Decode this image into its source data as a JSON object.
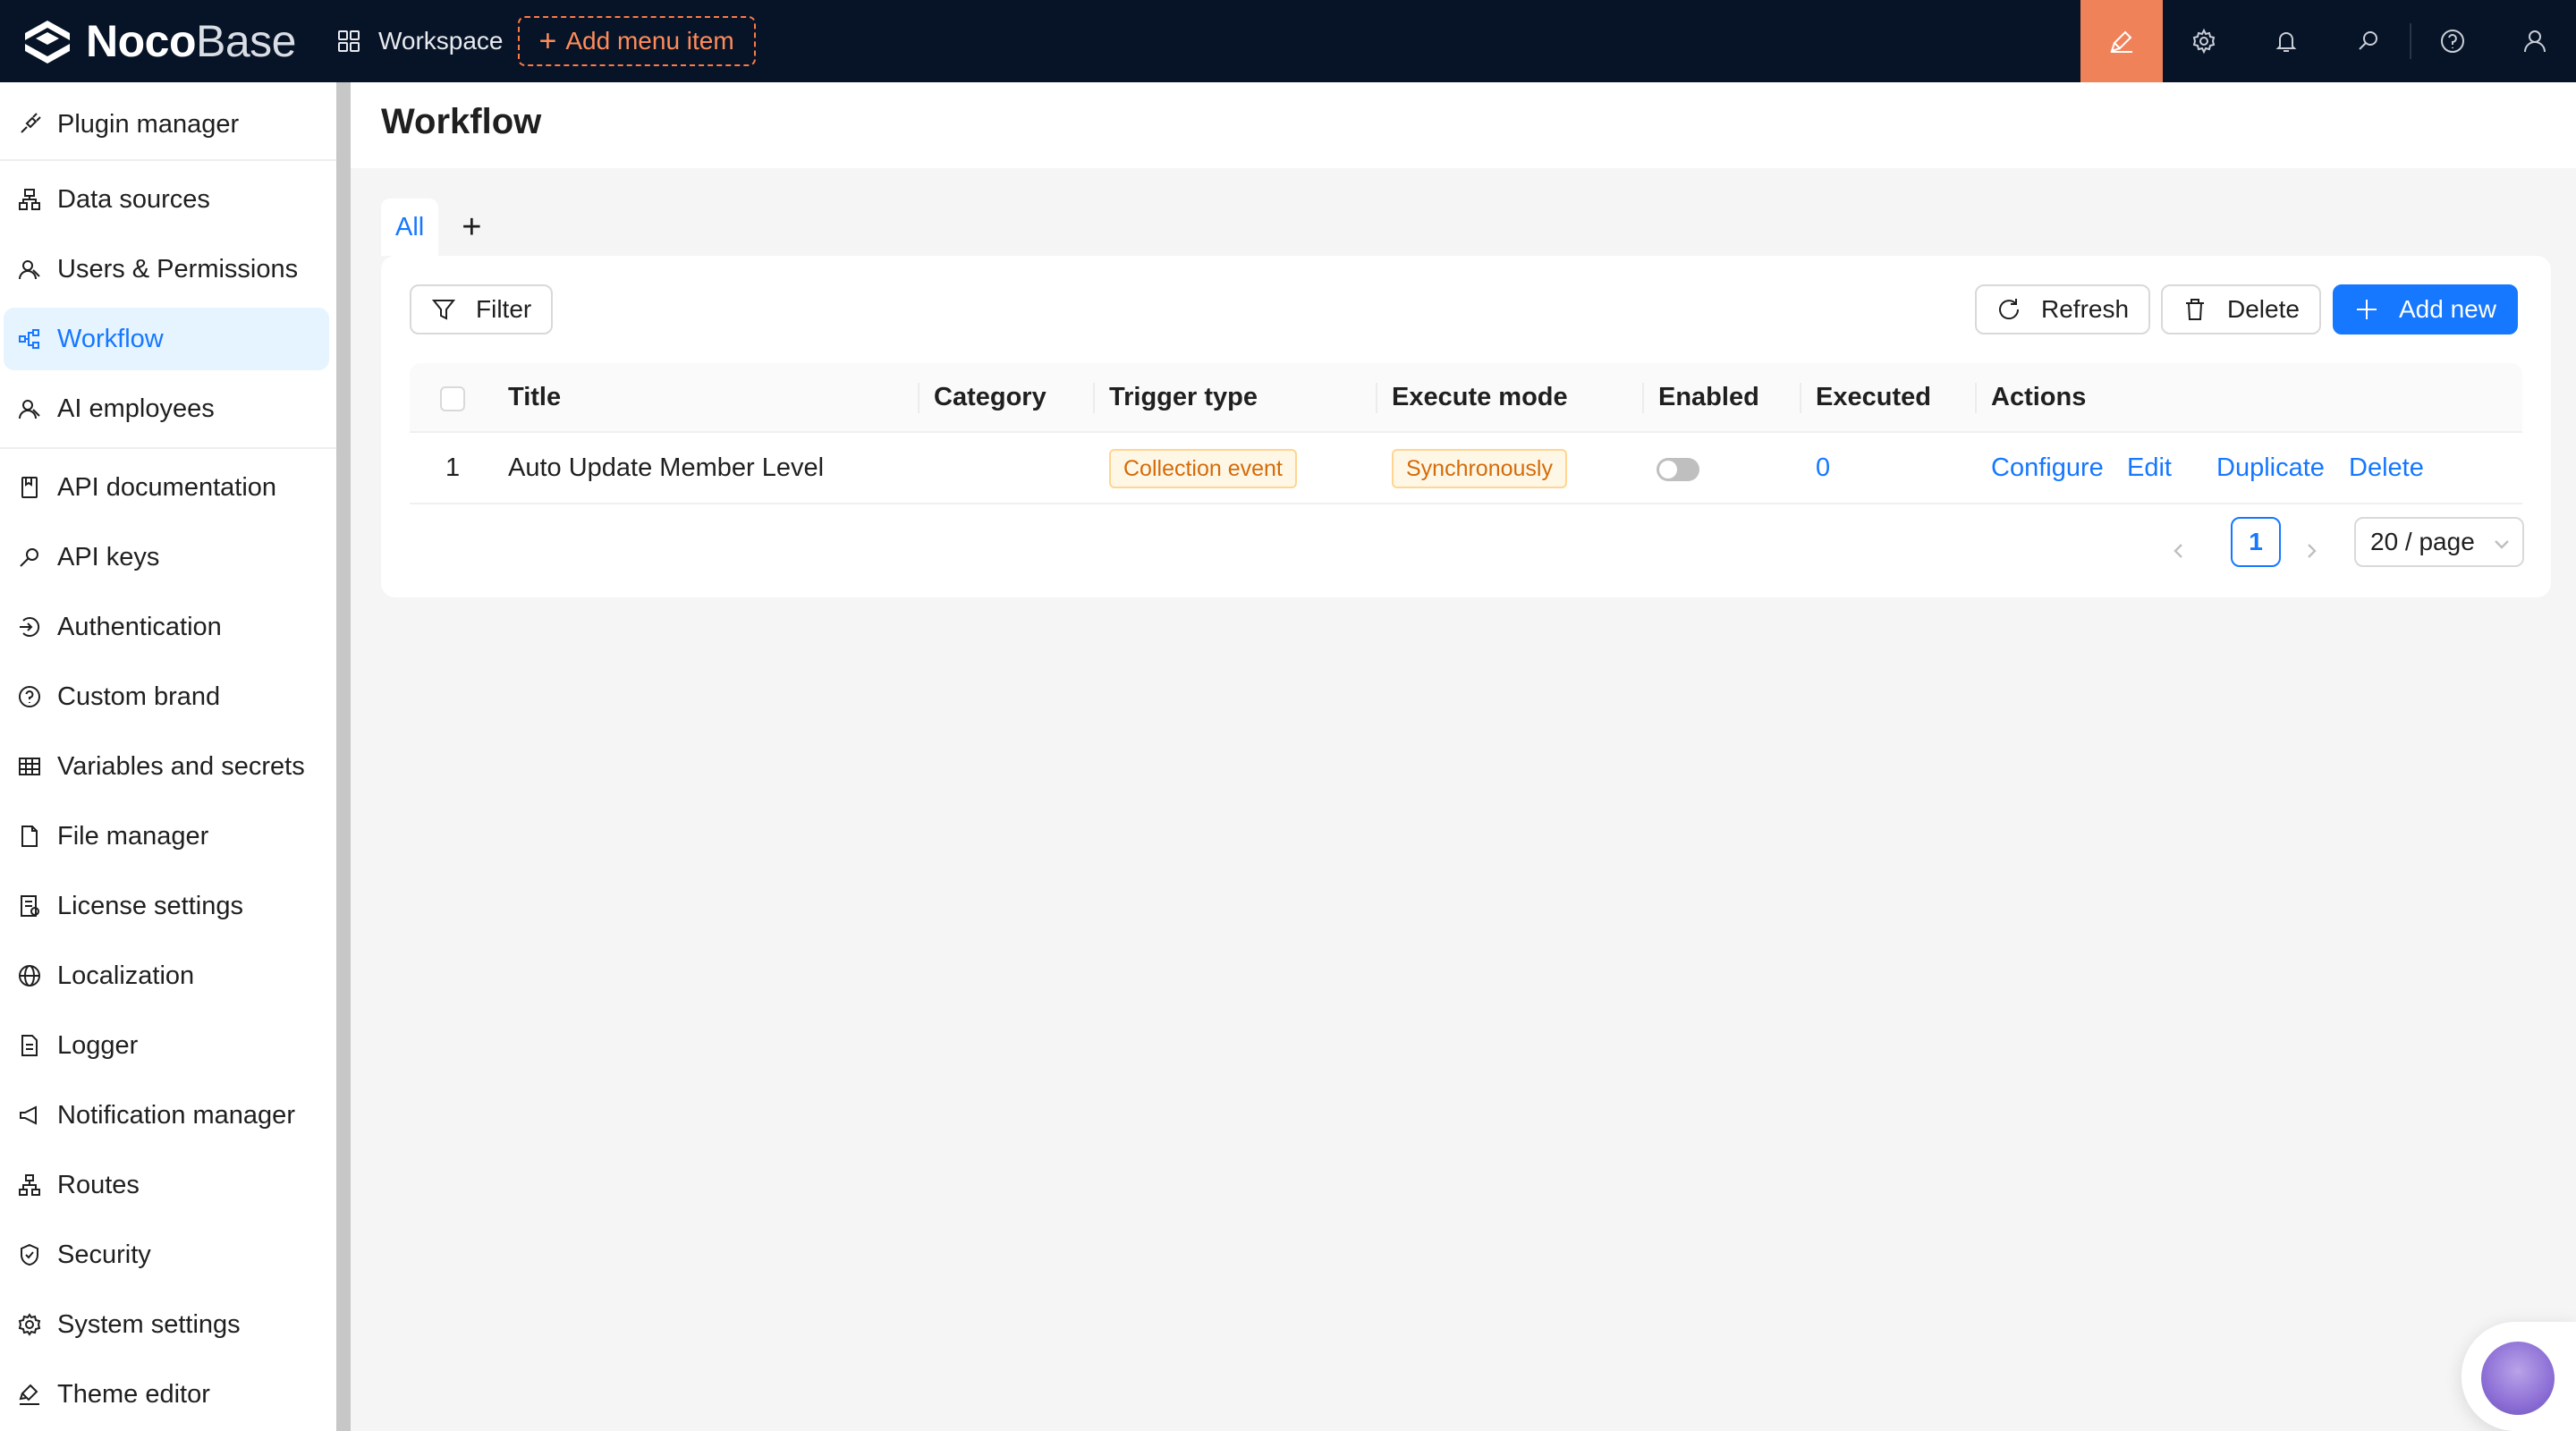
{
  "app": {
    "logo_bold": "Noco",
    "logo_thin": "Base",
    "workspace_label": "Workspace",
    "add_menu_label": "Add menu item"
  },
  "topbar_icons": [
    "brush-icon",
    "gear-icon",
    "bell-icon",
    "search-icon",
    "help-icon",
    "user-icon"
  ],
  "colors": {
    "topbar_bg": "#071326",
    "accent": "#1677ff",
    "active_tool": "#f0825a",
    "tag_bg": "#fff7e6",
    "tag_text": "#d46b08"
  },
  "sidebar": {
    "items": [
      {
        "label": "Plugin manager",
        "icon": "plug-icon"
      },
      {
        "label": "Data sources",
        "icon": "database-icon"
      },
      {
        "label": "Users & Permissions",
        "icon": "users-icon"
      },
      {
        "label": "Workflow",
        "icon": "workflow-icon",
        "active": true
      },
      {
        "label": "AI employees",
        "icon": "ai-employee-icon"
      },
      {
        "label": "API documentation",
        "icon": "book-icon"
      },
      {
        "label": "API keys",
        "icon": "key-icon"
      },
      {
        "label": "Authentication",
        "icon": "login-icon"
      },
      {
        "label": "Custom brand",
        "icon": "brand-icon"
      },
      {
        "label": "Variables and secrets",
        "icon": "table-icon"
      },
      {
        "label": "File manager",
        "icon": "file-icon"
      },
      {
        "label": "License settings",
        "icon": "license-icon"
      },
      {
        "label": "Localization",
        "icon": "globe-icon"
      },
      {
        "label": "Logger",
        "icon": "log-icon"
      },
      {
        "label": "Notification manager",
        "icon": "megaphone-icon"
      },
      {
        "label": "Routes",
        "icon": "routes-icon"
      },
      {
        "label": "Security",
        "icon": "shield-icon"
      },
      {
        "label": "System settings",
        "icon": "settings-icon"
      },
      {
        "label": "Theme editor",
        "icon": "paint-icon"
      }
    ]
  },
  "page": {
    "title": "Workflow",
    "tabs": [
      {
        "label": "All",
        "active": true
      }
    ],
    "tab_add_label": "+"
  },
  "toolbar": {
    "filter_label": "Filter",
    "refresh_label": "Refresh",
    "delete_label": "Delete",
    "add_new_label": "Add new"
  },
  "table": {
    "columns": [
      "Title",
      "Category",
      "Trigger type",
      "Execute mode",
      "Enabled",
      "Executed",
      "Actions"
    ],
    "rows": [
      {
        "index": "1",
        "title": "Auto Update Member Level",
        "category": "",
        "trigger_type": "Collection event",
        "execute_mode": "Synchronously",
        "enabled": false,
        "executed": "0",
        "actions": [
          "Configure",
          "Edit",
          "Duplicate",
          "Delete"
        ]
      }
    ]
  },
  "pagination": {
    "current_page": "1",
    "page_size": "20 / page"
  }
}
